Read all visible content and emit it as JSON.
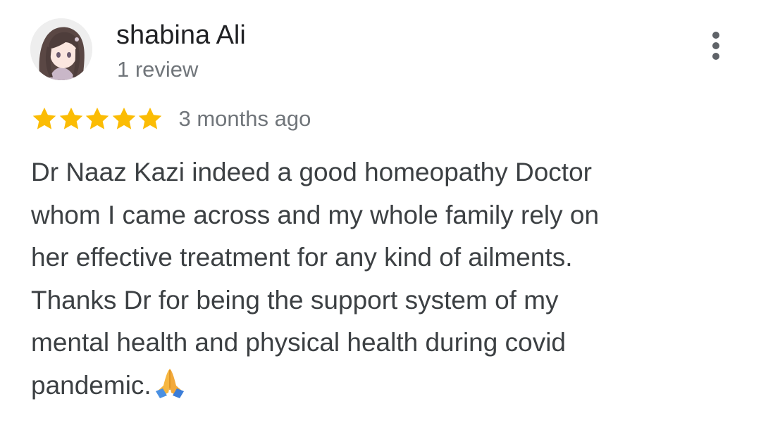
{
  "review": {
    "author_name": "shabina Ali",
    "review_count": "1 review",
    "rating": 5,
    "rating_max": 5,
    "time_ago": "3 months ago",
    "text_lines": [
      "Dr Naaz Kazi indeed a good homeopathy Doctor",
      "whom I came across and my whole family rely on",
      "her effective treatment for any kind of ailments.",
      "Thanks Dr for being the support system of my",
      "mental health and physical health during covid",
      "pandemic."
    ],
    "end_emoji": "folded-hands-icon"
  },
  "icons": {
    "avatar": "avatar-illustration",
    "more": "more-vert-icon",
    "star": "star-icon"
  },
  "colors": {
    "star": "#fbbc04",
    "name": "#202124",
    "secondary": "#70757a",
    "body_text": "#3c4043",
    "menu_dots": "#5f6368"
  }
}
